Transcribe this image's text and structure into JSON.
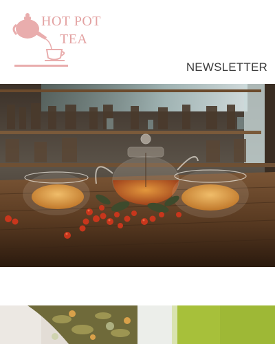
{
  "brand": {
    "line1": "HOT POT",
    "line2": "TEA",
    "logo_icon": "teapot-pouring-cup-icon",
    "color": "#e3a2a2"
  },
  "nav": {
    "newsletter_label": "NEWSLETTER"
  },
  "hero": {
    "image": "glass-teapot-with-two-cups-of-tea-and-berries-on-wooden-table"
  },
  "tiles": [
    {
      "image": "dried-herbal-tea-leaves"
    },
    {
      "image": "green-tea-in-glass"
    }
  ]
}
